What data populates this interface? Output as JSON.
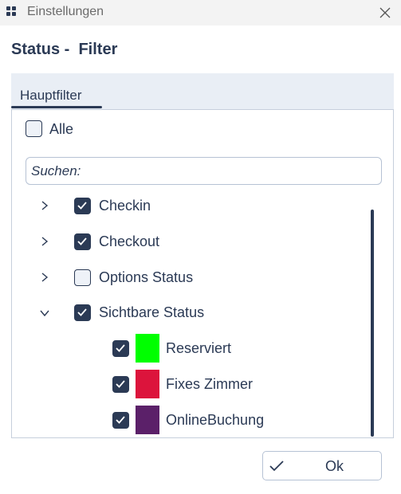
{
  "window": {
    "title": "Einstellungen"
  },
  "heading": "Status -  Filter",
  "tabs": [
    {
      "label": "Hauptfilter",
      "active": true
    }
  ],
  "filter": {
    "all": {
      "label": "Alle",
      "checked": false
    },
    "search_placeholder": "Suchen:",
    "tree": [
      {
        "label": "Checkin",
        "checked": true,
        "expanded": false
      },
      {
        "label": "Checkout",
        "checked": true,
        "expanded": false
      },
      {
        "label": "Options Status",
        "checked": false,
        "expanded": false
      },
      {
        "label": "Sichtbare Status",
        "checked": true,
        "expanded": true,
        "children": [
          {
            "label": "Reserviert",
            "checked": true,
            "color": "#00ff00"
          },
          {
            "label": "Fixes Zimmer",
            "checked": true,
            "color": "#dc143c"
          },
          {
            "label": "OnlineBuchung",
            "checked": true,
            "color": "#5b2069"
          }
        ]
      }
    ]
  },
  "footer": {
    "ok_label": "Ok"
  },
  "colors": {
    "primary": "#2b3a55",
    "tab_bg": "#e9eef5",
    "titlebar_bg": "#f3f3f3"
  }
}
